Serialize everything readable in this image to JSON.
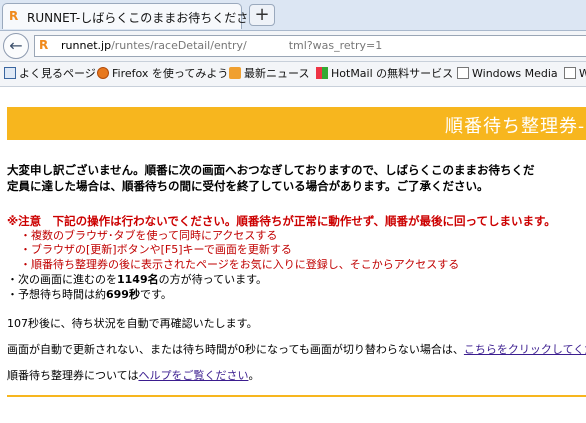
{
  "browser": {
    "tab_title": "RUNNET-しばらくこのままお待ちください",
    "newtab_label": "+",
    "back_glyph": "←",
    "url": {
      "domain": "runnet.jp",
      "path_prefix": "/runtes/raceDetail/entry/",
      "path_suffix": "tml?was_retry=1"
    },
    "bookmarks": [
      {
        "label": "よく見るページ",
        "icon": "star-icon"
      },
      {
        "label": "Firefox を使ってみよう",
        "icon": "firefox-icon"
      },
      {
        "label": "最新ニュース",
        "icon": "rss-icon"
      },
      {
        "label": "HotMail の無料サービス",
        "icon": "windows-icon"
      },
      {
        "label": "Windows Media",
        "icon": "page-icon"
      },
      {
        "label": "W",
        "icon": "page-icon"
      }
    ]
  },
  "page": {
    "banner_title": "順番待ち整理券-",
    "intro_line1": "大変申し訳ございません。順番に次の画面へおつなぎしておりますので、しばらくこのままお待ちくだ",
    "intro_line2": "定員に達した場合は、順番待ちの間に受付を終了している場合があります。ご了承ください。",
    "warning": "※注意　下記の操作は行わないでください。順番待ちが正常に動作せず、順番が最後に回ってしまいます。",
    "warning_items": [
      "・複数のブラウザ･タブを使って同時にアクセスする",
      "・ブラウザの[更新]ボタンや[F5]キーで画面を更新する",
      "・順番待ち整理券の後に表示されたページをお気に入りに登録し、そこからアクセスする"
    ],
    "queue": {
      "prefix": "・次の画面に進むのを",
      "count": "1149名",
      "suffix": "の方が待っています。"
    },
    "wait": {
      "prefix": "・予想待ち時間は約",
      "time": "699秒",
      "suffix": "です。"
    },
    "recheck": "107秒後に、待ち状況を自動で再確認いたします。",
    "manual": {
      "text": "画面が自動で更新されない、または待ち時間が0秒になっても画面が切り替わらない場合は、",
      "link": "こちらをクリックしてくだ"
    },
    "help": {
      "prefix": "順番待ち整理券については",
      "link": "ヘルプをご覧ください",
      "suffix": "。"
    }
  },
  "colors": {
    "accent": "#f7b61e",
    "warning": "#cc0000",
    "link": "#3b1d8f"
  }
}
